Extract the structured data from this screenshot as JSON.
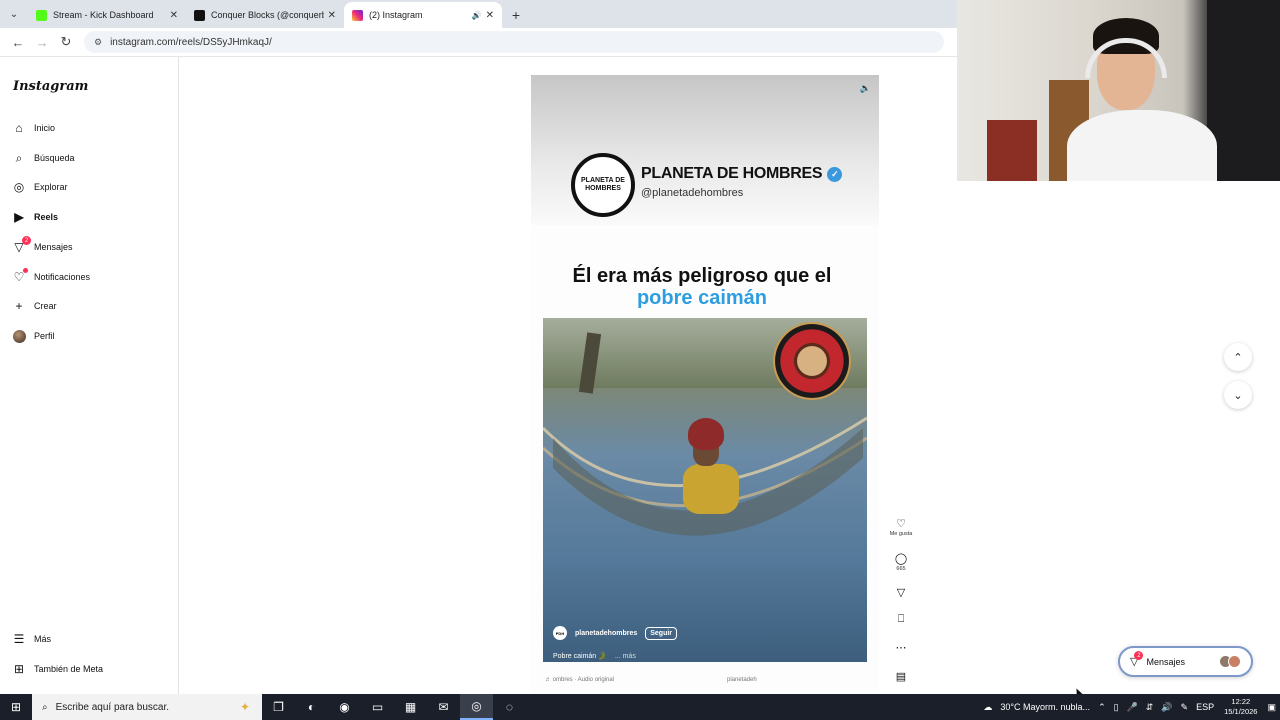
{
  "browser": {
    "tabs": [
      {
        "title": "Stream - Kick Dashboard",
        "favicon_color": "#53fc18",
        "active": false
      },
      {
        "title": "Conquer Blocks (@conquerblocks)",
        "favicon_color": "#111111",
        "active": false
      },
      {
        "title": "(2) Instagram",
        "favicon_color": "#e1306c",
        "active": true
      }
    ],
    "url": "instagram.com/reels/DS5yJHmkaqJ/"
  },
  "sidebar": {
    "logo": "Instagram",
    "items": [
      {
        "label": "Inicio",
        "icon": "home-icon"
      },
      {
        "label": "Búsqueda",
        "icon": "search-icon"
      },
      {
        "label": "Explorar",
        "icon": "compass-icon"
      },
      {
        "label": "Reels",
        "icon": "reels-icon",
        "bold": true
      },
      {
        "label": "Mensajes",
        "icon": "messenger-icon",
        "badge": "2"
      },
      {
        "label": "Notificaciones",
        "icon": "heart-icon"
      },
      {
        "label": "Crear",
        "icon": "plus-icon"
      },
      {
        "label": "Perfil",
        "icon": "avatar-icon"
      }
    ],
    "bottom": [
      {
        "label": "Más",
        "icon": "menu-icon"
      },
      {
        "label": "También de Meta",
        "icon": "meta-icon"
      }
    ]
  },
  "reel": {
    "brand_logo_text": "PLANETA DE HOMBRES",
    "brand_name": "PLANETA DE HOMBRES",
    "brand_handle": "@planetadehombres",
    "headline_part1": "Él era más peligroso que el",
    "headline_part2": "pobre caimán",
    "username": "planetadehombres",
    "follow_label": "Seguir",
    "caption": "Pobre caimán 🐊",
    "caption_more": "... más",
    "audio": "♬ ombres · Audio original",
    "audio_right": "planetadeh"
  },
  "actions": {
    "like_label": "Me gusta",
    "comments_count": "665"
  },
  "messages_pill": {
    "label": "Mensajes",
    "badge": "2"
  },
  "taskbar": {
    "search_placeholder": "Escribe aquí para buscar.",
    "weather": "30°C  Mayorm. nubla...",
    "lang": "ESP",
    "time": "12:22",
    "date": "15/1/2026"
  }
}
